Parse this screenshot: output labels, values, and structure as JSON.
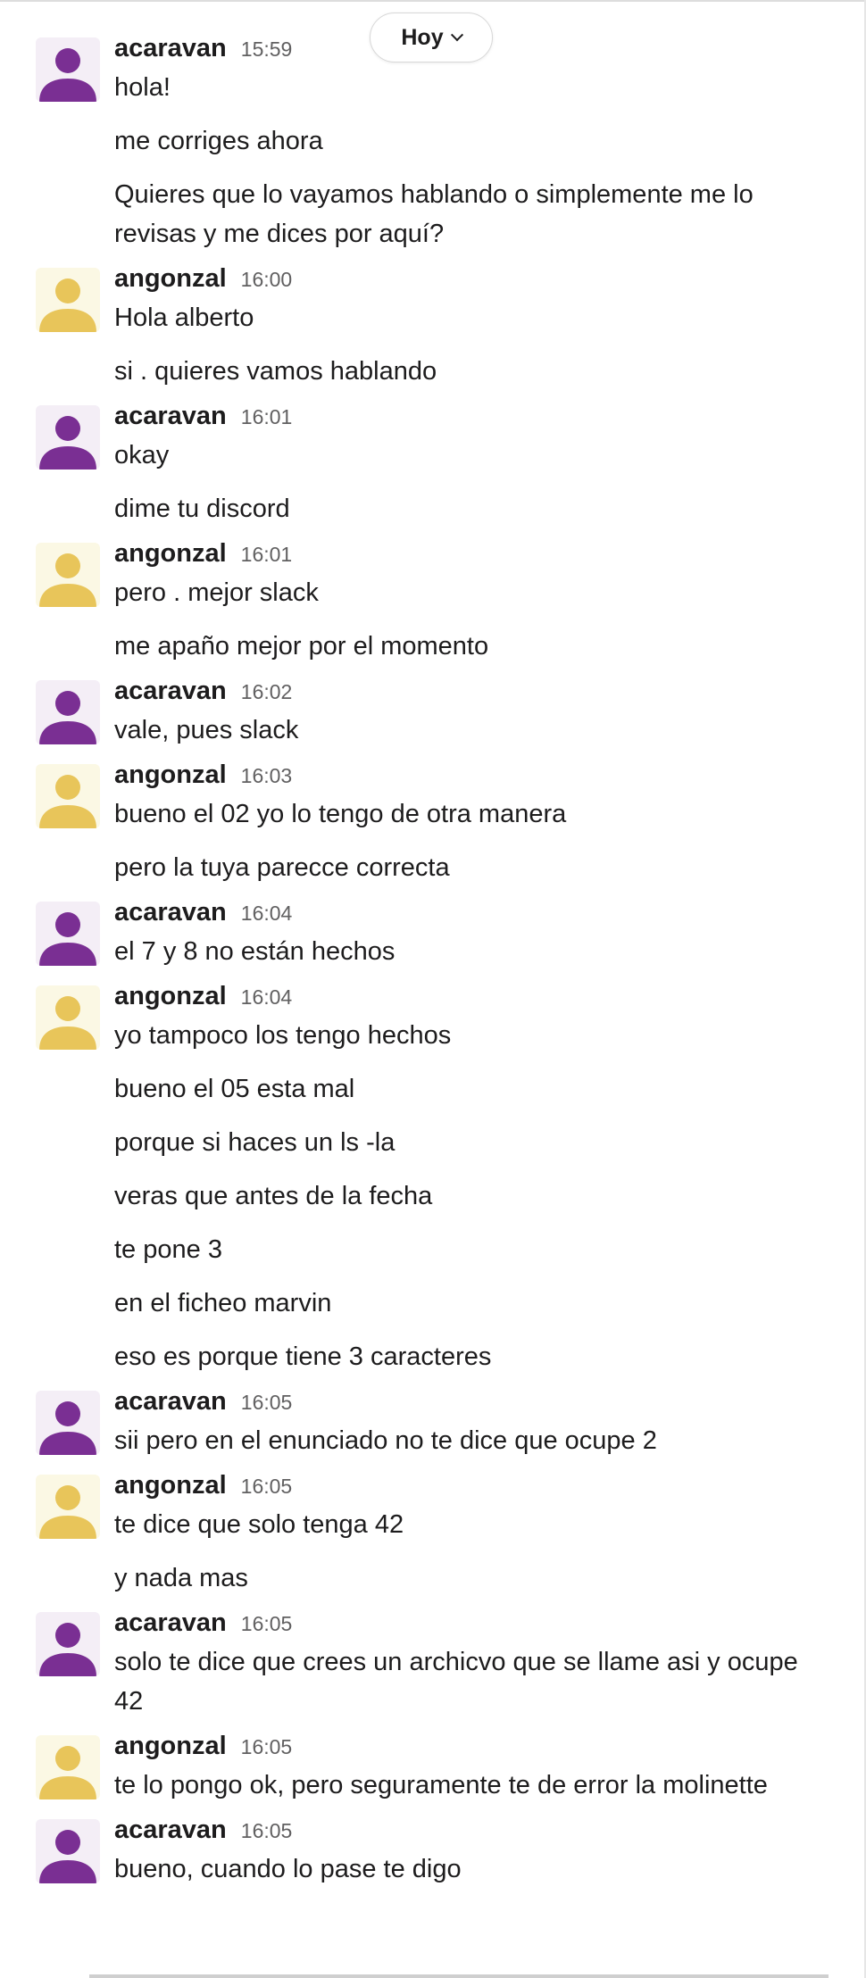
{
  "date_divider": {
    "label": "Hoy"
  },
  "colors": {
    "purple_user": "#7a2f93",
    "yellow_user": "#e8c55a",
    "yellow_bg": "#fbf8e4"
  },
  "messages": [
    {
      "user": "acaravan",
      "time": "15:59",
      "lines": [
        "hola!",
        "me corriges ahora",
        "Quieres que lo vayamos hablando o simplemente me lo revisas y me dices por aquí?"
      ]
    },
    {
      "user": "angonzal",
      "time": "16:00",
      "lines": [
        "Hola alberto",
        "si . quieres vamos hablando"
      ]
    },
    {
      "user": "acaravan",
      "time": "16:01",
      "lines": [
        "okay",
        "dime tu discord"
      ]
    },
    {
      "user": "angonzal",
      "time": "16:01",
      "lines": [
        "pero . mejor slack",
        "me apaño mejor por el momento"
      ]
    },
    {
      "user": "acaravan",
      "time": "16:02",
      "lines": [
        "vale, pues slack"
      ]
    },
    {
      "user": "angonzal",
      "time": "16:03",
      "lines": [
        "bueno el 02 yo lo tengo de otra manera",
        "pero la tuya parecce correcta"
      ]
    },
    {
      "user": "acaravan",
      "time": "16:04",
      "lines": [
        "el 7 y 8 no están hechos"
      ]
    },
    {
      "user": "angonzal",
      "time": "16:04",
      "lines": [
        "yo tampoco los tengo hechos",
        "bueno el 05 esta mal",
        "porque si haces un ls -la",
        "veras que antes de la fecha",
        "te pone 3",
        "en el ficheo marvin",
        "eso es porque tiene 3 caracteres"
      ]
    },
    {
      "user": "acaravan",
      "time": "16:05",
      "lines": [
        "sii pero en el enunciado no te dice que ocupe 2"
      ]
    },
    {
      "user": "angonzal",
      "time": "16:05",
      "lines": [
        "te dice que solo tenga 42",
        "y nada mas"
      ]
    },
    {
      "user": "acaravan",
      "time": "16:05",
      "lines": [
        "solo te dice que crees un archicvo que se llame asi y ocupe 42"
      ]
    },
    {
      "user": "angonzal",
      "time": "16:05",
      "lines": [
        "te lo pongo ok, pero seguramente te de error la molinette"
      ]
    },
    {
      "user": "acaravan",
      "time": "16:05",
      "lines": [
        "bueno, cuando lo pase te digo"
      ]
    }
  ]
}
